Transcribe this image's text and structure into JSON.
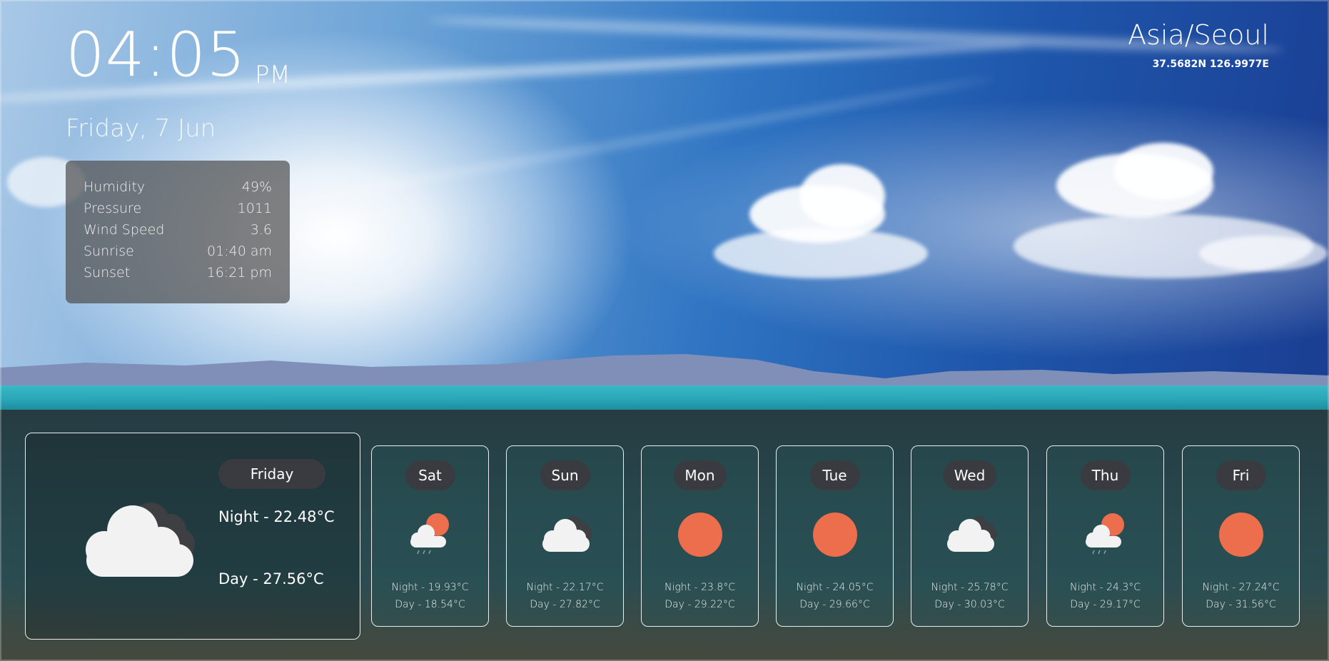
{
  "clock": {
    "time": "04:05",
    "ampm": "PM",
    "date": "Friday, 7 Jun"
  },
  "location": {
    "timezone": "Asia/Seoul",
    "coords": "37.5682N 126.9977E"
  },
  "stats": [
    {
      "label": "Humidity",
      "value": "49%"
    },
    {
      "label": "Pressure",
      "value": "1011"
    },
    {
      "label": "Wind Speed",
      "value": "3.6"
    },
    {
      "label": "Sunrise",
      "value": "01:40 am"
    },
    {
      "label": "Sunset",
      "value": "16:21 pm"
    }
  ],
  "today": {
    "day": "Friday",
    "night": "Night - 22.48°C",
    "day_temp": "Day - 27.56°C",
    "icon": "cloudy-icon"
  },
  "forecast": [
    {
      "day": "Sat",
      "night": "Night - 19.93°C",
      "day_temp": "Day - 18.54°C",
      "icon": "rain-sun-icon"
    },
    {
      "day": "Sun",
      "night": "Night - 22.17°C",
      "day_temp": "Day - 27.82°C",
      "icon": "cloudy-icon"
    },
    {
      "day": "Mon",
      "night": "Night - 23.8°C",
      "day_temp": "Day - 29.22°C",
      "icon": "sun-icon"
    },
    {
      "day": "Tue",
      "night": "Night - 24.05°C",
      "day_temp": "Day - 29.66°C",
      "icon": "sun-icon"
    },
    {
      "day": "Wed",
      "night": "Night - 25.78°C",
      "day_temp": "Day - 30.03°C",
      "icon": "cloudy-icon"
    },
    {
      "day": "Thu",
      "night": "Night - 24.3°C",
      "day_temp": "Day - 29.17°C",
      "icon": "rain-sun-icon"
    },
    {
      "day": "Fri",
      "night": "Night - 27.24°C",
      "day_temp": "Day - 31.56°C",
      "icon": "sun-icon"
    }
  ],
  "colors": {
    "sun": "#ec6e4c",
    "cloud": "#f2f2f2",
    "cloud_dark": "#3d3f43",
    "pill": "#3a3b40"
  }
}
